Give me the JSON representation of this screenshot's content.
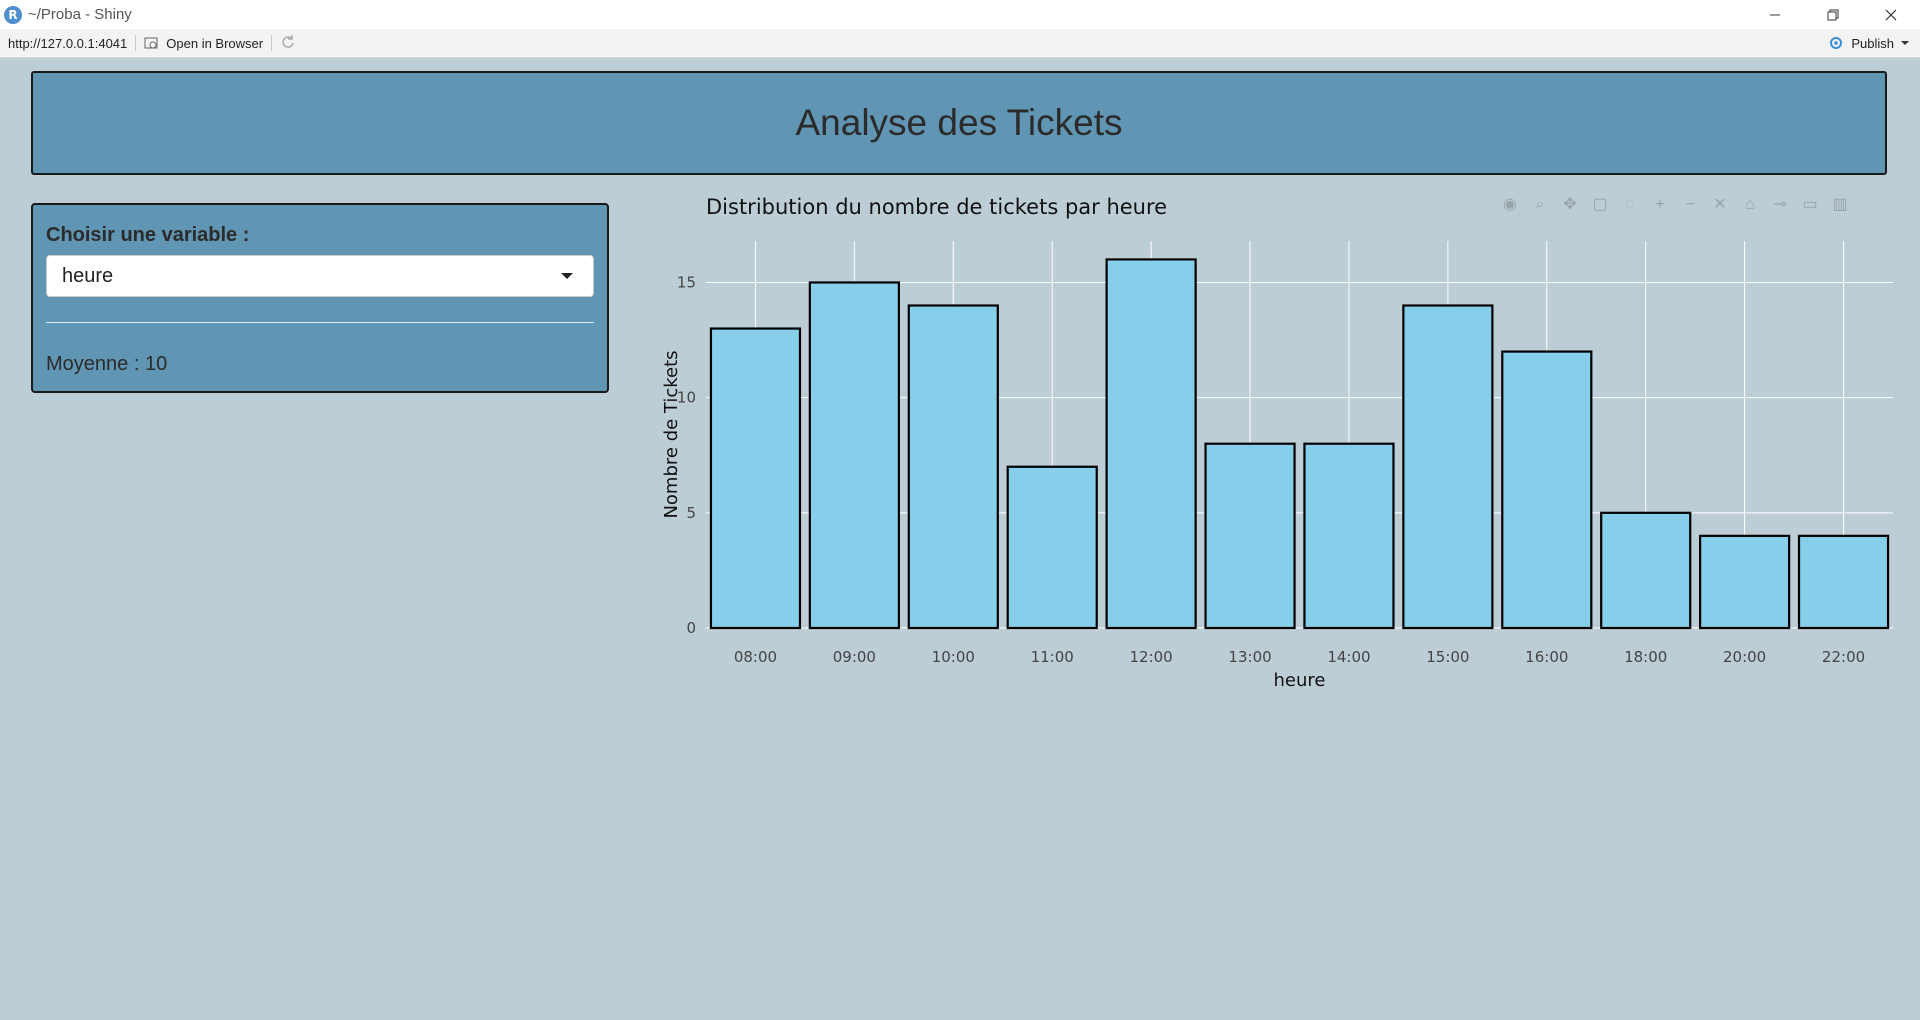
{
  "window": {
    "title": "~/Proba - Shiny",
    "logo_letter": "R"
  },
  "toolbar": {
    "url": "http://127.0.0.1:4041",
    "open_in_browser": "Open in Browser",
    "publish": "Publish"
  },
  "app": {
    "title": "Analyse des Tickets",
    "sidebar": {
      "label": "Choisir une variable :",
      "selected": "heure",
      "mean_text": "Moyenne : 10"
    }
  },
  "colors": {
    "panel": "#6095b4",
    "background": "#bdcdd6",
    "bar_fill": "#87ceeb",
    "bar_stroke": "#000000"
  },
  "modebar_icons": [
    "camera-icon",
    "zoom-icon",
    "pan-icon",
    "box-select-icon",
    "lasso-icon",
    "zoom-in-icon",
    "zoom-out-icon",
    "autoscale-icon",
    "reset-axes-icon",
    "spike-lines-icon",
    "hover-closest-icon",
    "plotly-logo-icon"
  ],
  "chart_data": {
    "type": "bar",
    "title": "Distribution du nombre de tickets par heure",
    "xlabel": "heure",
    "ylabel": "Nombre de Tickets",
    "categories": [
      "08:00",
      "09:00",
      "10:00",
      "11:00",
      "12:00",
      "13:00",
      "14:00",
      "15:00",
      "16:00",
      "18:00",
      "20:00",
      "22:00"
    ],
    "values": [
      13,
      15,
      14,
      7,
      16,
      8,
      8,
      14,
      12,
      5,
      4,
      4
    ],
    "yticks": [
      0,
      5,
      10,
      15
    ],
    "ylim": [
      0,
      16.8
    ],
    "grid": true
  }
}
